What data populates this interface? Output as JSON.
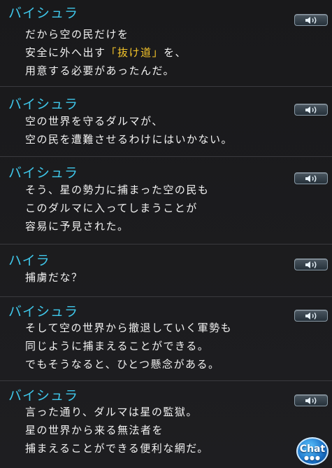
{
  "entries": [
    {
      "speaker": "バイシュラ",
      "lines": [
        {
          "parts": [
            {
              "text": "だから空の民だけを"
            }
          ]
        },
        {
          "parts": [
            {
              "text": "安全に外へ出す"
            },
            {
              "text": "「抜け道」",
              "highlight": true
            },
            {
              "text": "を、"
            }
          ]
        },
        {
          "parts": [
            {
              "text": "用意する必要があったんだ。"
            }
          ]
        }
      ]
    },
    {
      "speaker": "バイシュラ",
      "lines": [
        {
          "parts": [
            {
              "text": "空の世界を守るダルマが、"
            }
          ]
        },
        {
          "parts": [
            {
              "text": "空の民を遭難させるわけにはいかない。"
            }
          ]
        }
      ]
    },
    {
      "speaker": "バイシュラ",
      "lines": [
        {
          "parts": [
            {
              "text": "そう、星の勢力に捕まった空の民も"
            }
          ]
        },
        {
          "parts": [
            {
              "text": "このダルマに入ってしまうことが"
            }
          ]
        },
        {
          "parts": [
            {
              "text": "容易に予見された。"
            }
          ]
        }
      ]
    },
    {
      "speaker": "ハイラ",
      "lines": [
        {
          "parts": [
            {
              "text": "捕虜だな？"
            }
          ]
        }
      ]
    },
    {
      "speaker": "バイシュラ",
      "lines": [
        {
          "parts": [
            {
              "text": "そして空の世界から撤退していく軍勢も"
            }
          ]
        },
        {
          "parts": [
            {
              "text": "同じように捕まえることができる。"
            }
          ]
        },
        {
          "parts": [
            {
              "text": "でもそうなると、ひとつ懸念がある。"
            }
          ]
        }
      ]
    },
    {
      "speaker": "バイシュラ",
      "lines": [
        {
          "parts": [
            {
              "text": "言った通り、ダルマは星の監獄。"
            }
          ]
        },
        {
          "parts": [
            {
              "text": "星の世界から来る無法者を"
            }
          ]
        },
        {
          "parts": [
            {
              "text": "捕まえることができる便利な網だ。"
            }
          ]
        }
      ]
    }
  ],
  "chat_button": {
    "label": "Chat",
    "dots": "●●●"
  },
  "colors": {
    "speaker": "#3fc7ea",
    "text": "#f2f2f2",
    "highlight": "#f4c42a",
    "background": "#1b1b1d"
  }
}
